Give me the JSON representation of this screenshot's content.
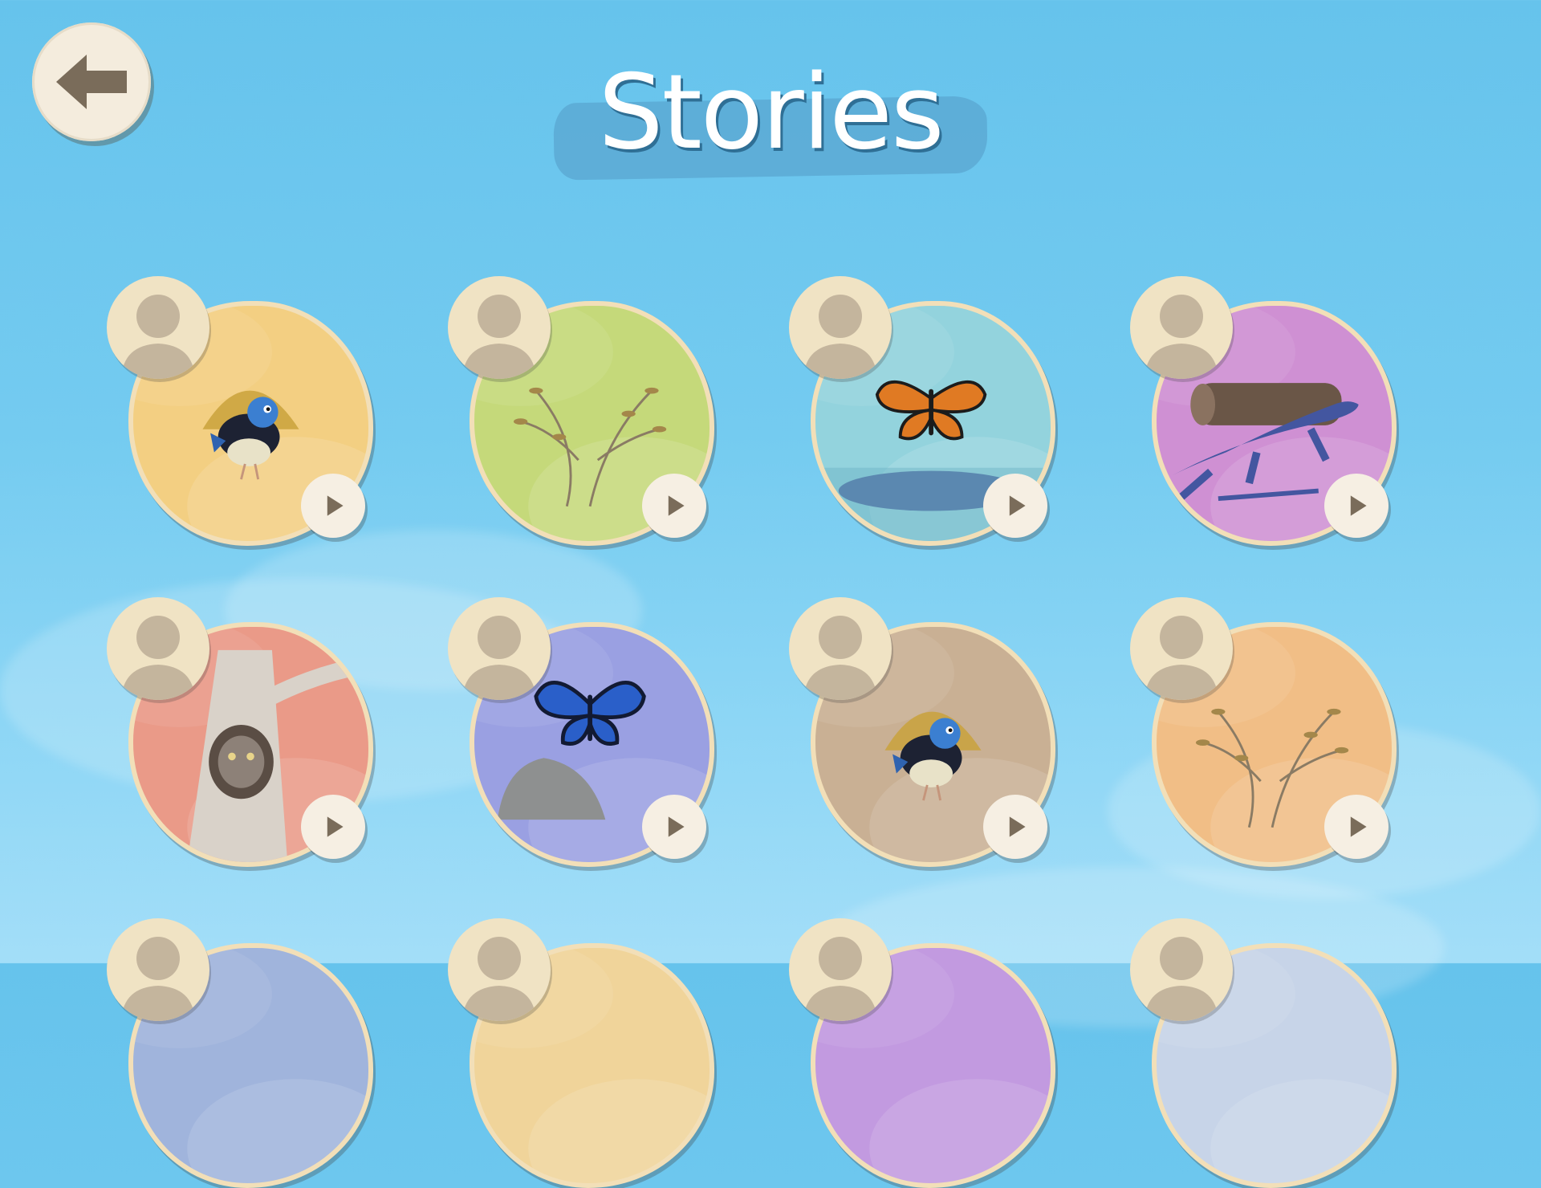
{
  "header": {
    "title": "Stories",
    "back_icon": "arrow-left-icon"
  },
  "colors": {
    "sky": "#6cc5ee",
    "card_border": "#f2dfb8",
    "button_face": "#f6efe3",
    "icon_brown": "#786a58"
  },
  "stories": [
    {
      "name": "story-fairy-wren-yellow",
      "background": "#f3cf82",
      "illustration": "fairy-wren-icon"
    },
    {
      "name": "story-grass-green",
      "background": "#c5d97a",
      "illustration": "grass-tree-icon"
    },
    {
      "name": "story-butterfly-pond",
      "background": "#93d3dd",
      "illustration": "monarch-butterfly-icon"
    },
    {
      "name": "story-lizard-log",
      "background": "#cf90d3",
      "illustration": "blue-tongue-lizard-icon"
    },
    {
      "name": "story-frogmouth-tree",
      "background": "#ea9a88",
      "illustration": "tawny-frogmouth-icon"
    },
    {
      "name": "story-blue-butterfly",
      "background": "#9aa0e2",
      "illustration": "blue-butterfly-icon"
    },
    {
      "name": "story-fairy-wren-brown",
      "background": "#c9b094",
      "illustration": "fairy-wren-icon"
    },
    {
      "name": "story-grass-orange",
      "background": "#f1be86",
      "illustration": "grass-tree-icon"
    },
    {
      "name": "story-partial-1",
      "background": "#a0b4dc",
      "illustration": "story-illustration"
    },
    {
      "name": "story-partial-2",
      "background": "#f0d49a",
      "illustration": "story-illustration"
    },
    {
      "name": "story-partial-3",
      "background": "#c29ae0",
      "illustration": "story-illustration"
    },
    {
      "name": "story-partial-4",
      "background": "#c7d4e8",
      "illustration": "story-illustration"
    }
  ]
}
